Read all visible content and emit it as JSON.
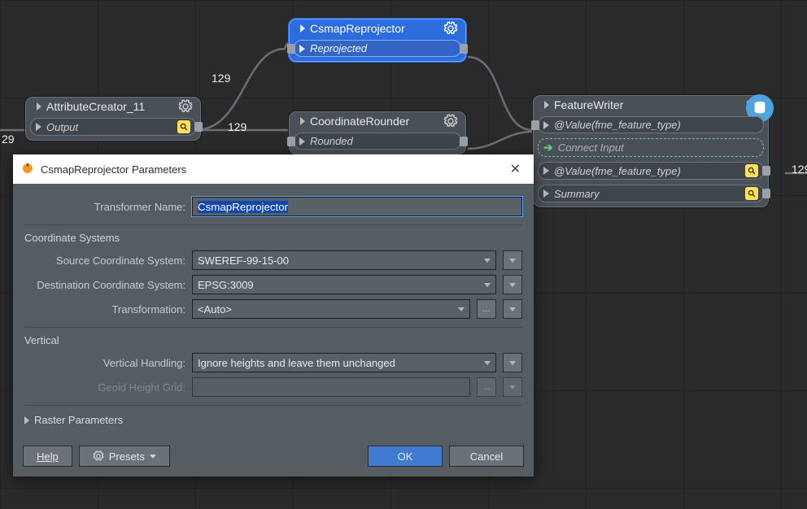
{
  "nodes": {
    "attrCreator": {
      "title": "AttributeCreator_11",
      "port_out": "Output",
      "count_in": "29",
      "count_out": "129"
    },
    "csmap": {
      "title": "CsmapReprojector",
      "port_out": "Reprojected",
      "count_in": "129"
    },
    "coordRounder": {
      "title": "CoordinateRounder",
      "port_rounded": "Rounded",
      "count_in": "129"
    },
    "featureWriter": {
      "title": "FeatureWriter",
      "port_in": "@Value(fme_feature_type)",
      "connect": "Connect Input",
      "port_out1": "@Value(fme_feature_type)",
      "port_out2": "Summary",
      "count_right": "129"
    }
  },
  "dialog": {
    "title": "CsmapReprojector Parameters",
    "close": "✕",
    "labels": {
      "transformerName": "Transformer Name:",
      "coordSystems": "Coordinate Systems",
      "source": "Source Coordinate System:",
      "dest": "Destination Coordinate System:",
      "transformation": "Transformation:",
      "vertical": "Vertical",
      "vhandling": "Vertical Handling:",
      "geoid": "Geoid Height Grid:",
      "raster": "Raster Parameters"
    },
    "values": {
      "transformerName": "CsmapReprojector",
      "source": "SWEREF-99-15-00",
      "dest": "EPSG:3009",
      "transformation": "<Auto>",
      "vhandling": "Ignore heights and leave them unchanged",
      "geoid": ""
    },
    "buttons": {
      "help": "Help",
      "presets": "Presets",
      "ok": "OK",
      "cancel": "Cancel"
    },
    "ellipsis": "..."
  }
}
